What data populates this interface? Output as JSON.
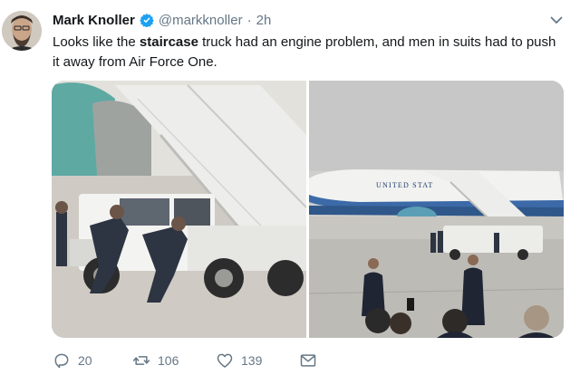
{
  "tweet": {
    "author_name": "Mark Knoller",
    "handle": "@markknoller",
    "separator": "·",
    "time": "2h",
    "text_before": "Looks like the ",
    "text_bold": "staircase",
    "text_after": " truck had an engine problem, and men in suits had to push it away from Air Force One.",
    "plane_lettering": "UNITED STAT"
  },
  "actions": {
    "reply_count": "20",
    "retweet_count": "106",
    "like_count": "139"
  },
  "icons": {
    "verified": "verified-badge-icon",
    "more": "chevron-down-icon",
    "reply": "reply-icon",
    "retweet": "retweet-icon",
    "like": "heart-icon",
    "dm": "envelope-icon"
  },
  "colors": {
    "verified": "#1da1f2",
    "secondary_text": "#657786",
    "primary_text": "#14171a"
  }
}
